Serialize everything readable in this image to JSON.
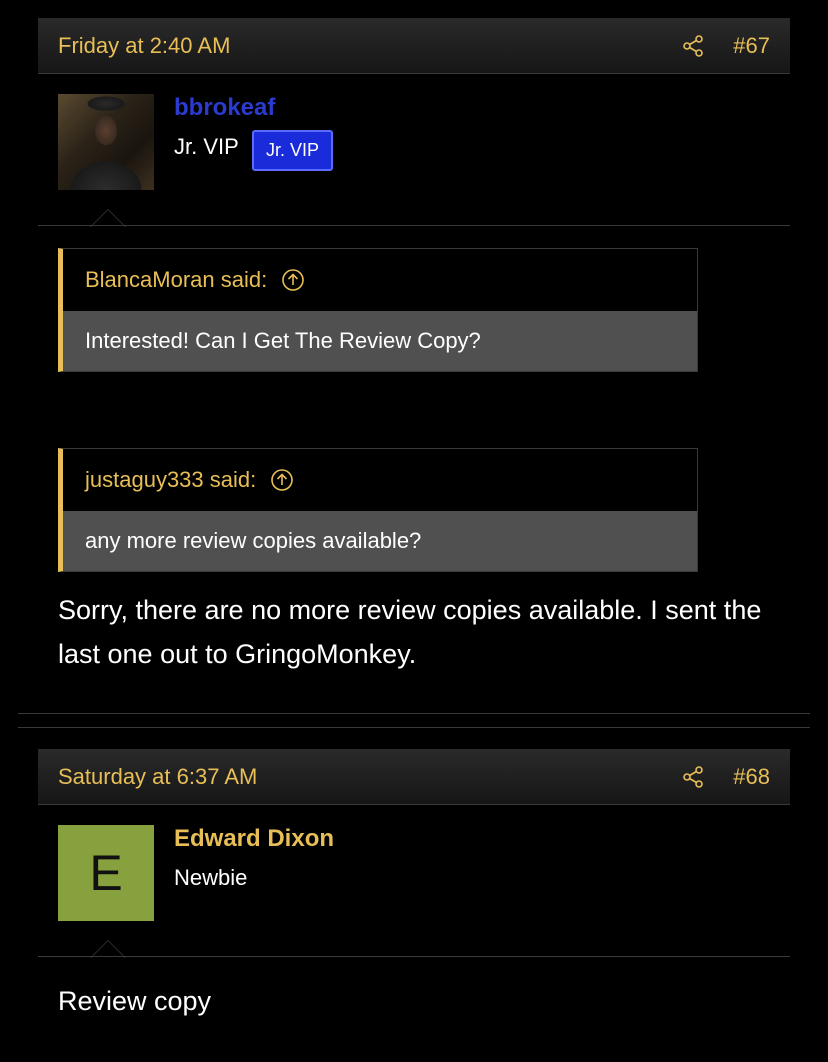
{
  "posts": [
    {
      "timestamp": "Friday at 2:40 AM",
      "post_number": "#67",
      "username": "bbrokeaf",
      "username_color": "#2b3bcf",
      "user_title": "Jr. VIP",
      "badge": "Jr. VIP",
      "quotes": [
        {
          "author": "BlancaMoran said:",
          "text": "Interested! Can I Get The Review Copy?"
        },
        {
          "author": "justaguy333 said:",
          "text": "any more review copies available?"
        }
      ],
      "message": "Sorry, there are no more review copies available. I sent the last one out to GringoMonkey."
    },
    {
      "timestamp": "Saturday at 6:37 AM",
      "post_number": "#68",
      "avatar_letter": "E",
      "username": "Edward Dixon",
      "username_color": "#e8bf57",
      "user_title": "Newbie",
      "message": "Review copy"
    }
  ],
  "icons": {
    "share": "share-icon",
    "quote_jump": "arrow-up-circle-icon"
  },
  "colors": {
    "accent": "#e8bf57",
    "badge_bg": "#1a2bd9",
    "avatar_letter_bg": "#86a13d"
  }
}
